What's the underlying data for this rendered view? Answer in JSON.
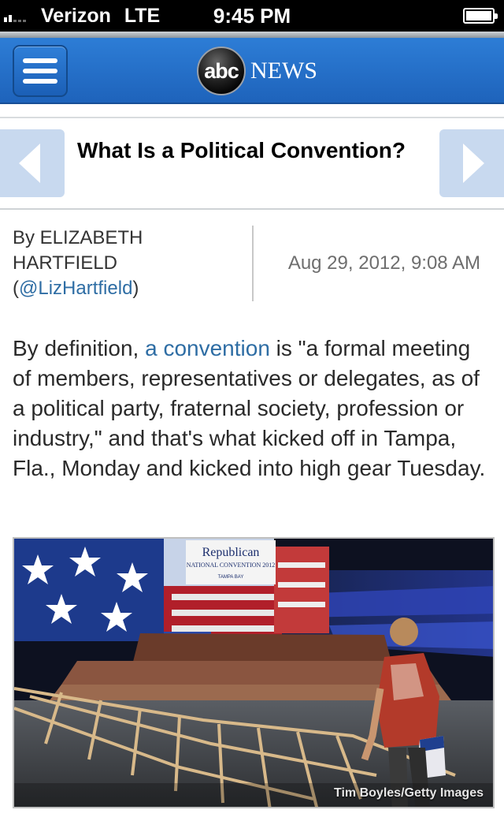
{
  "status_bar": {
    "carrier": "Verizon",
    "network": "LTE",
    "time": "9:45 PM",
    "battery_level": 0.95
  },
  "header": {
    "menu_icon": "hamburger-menu-icon",
    "logo_abc": "abc",
    "logo_news": "NEWS",
    "brand_color": "#1e63bb"
  },
  "article": {
    "title": "What Is a Political Convention?",
    "byline_prefix": "By ELIZABETH HARTFIELD (",
    "byline_handle": "@LizHartfield",
    "byline_suffix": ")",
    "date": "Aug 29, 2012, 9:08 AM",
    "body_start": "By definition, ",
    "body_link": "a convention",
    "body_rest": " is \"a formal meeting of members, representatives or delegates, as of a political party, fraternal society, profession or industry,\" and that's what kicked off in Tampa, Fla., Monday and kicked into high gear Tuesday.",
    "link_color": "#2e6da4",
    "photo": {
      "sign_line1": "Republican",
      "sign_line2": "NATIONAL CONVENTION 2012",
      "sign_line3": "TAMPA BAY",
      "credit": "Tim Boyles/Getty Images"
    }
  },
  "nav": {
    "prev_icon": "chevron-left-icon",
    "next_icon": "chevron-right-icon"
  }
}
